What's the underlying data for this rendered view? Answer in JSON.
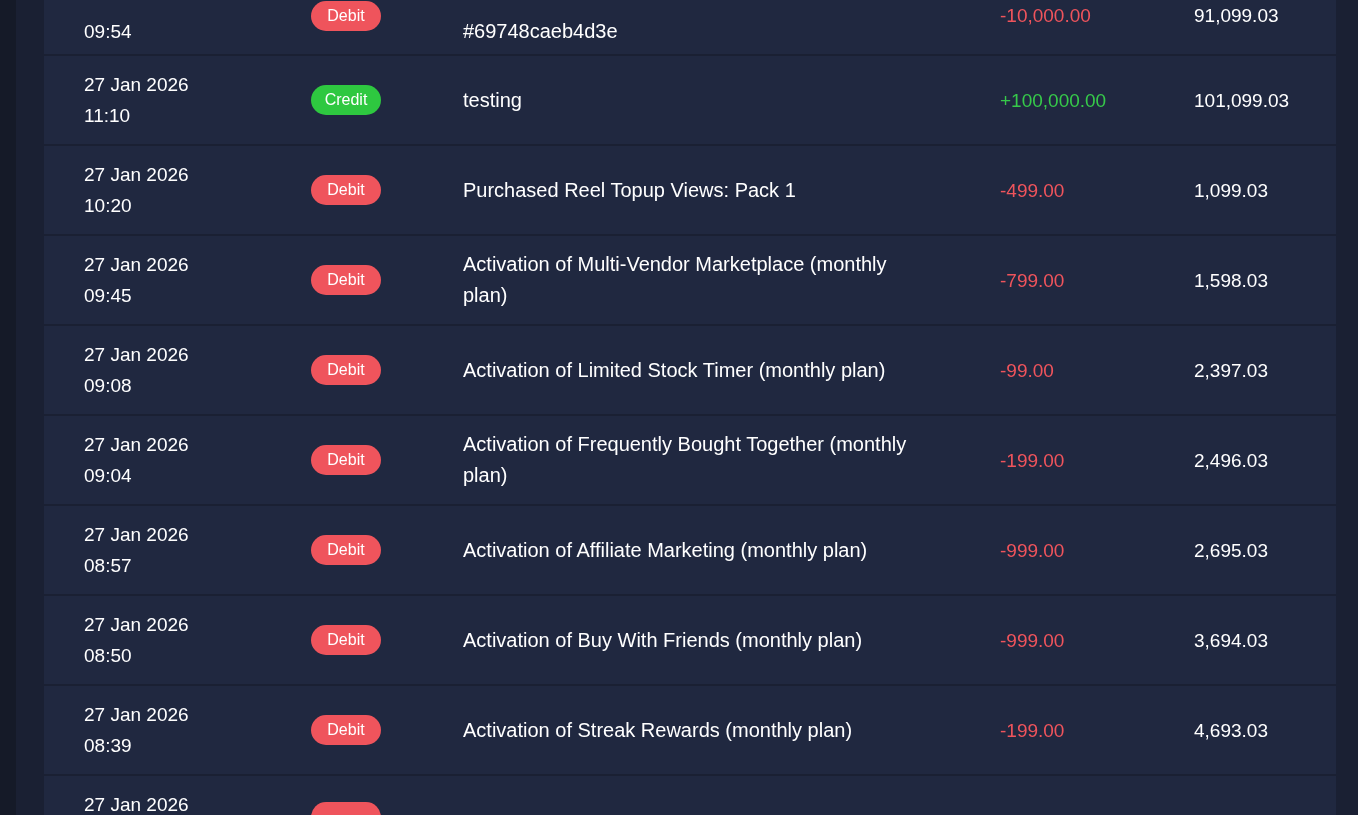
{
  "transactions": [
    {
      "kind": "cut_top",
      "time": "09:54",
      "credit": false,
      "type_label": "Debit",
      "description": "#69748caeb4d3e",
      "amount": "-10,000.00",
      "balance": "91,099.03"
    },
    {
      "kind": "full",
      "date": "27 Jan 2026",
      "time": "11:10",
      "credit": true,
      "type_label": "Credit",
      "description": "testing",
      "amount": "+100,000.00",
      "balance": "101,099.03"
    },
    {
      "kind": "full",
      "date": "27 Jan 2026",
      "time": "10:20",
      "credit": false,
      "type_label": "Debit",
      "description": "Purchased Reel Topup Views: Pack 1",
      "amount": "-499.00",
      "balance": "1,099.03"
    },
    {
      "kind": "full",
      "date": "27 Jan 2026",
      "time": "09:45",
      "credit": false,
      "type_label": "Debit",
      "description": "Activation of Multi-Vendor Marketplace (monthly plan)",
      "amount": "-799.00",
      "balance": "1,598.03"
    },
    {
      "kind": "full",
      "date": "27 Jan 2026",
      "time": "09:08",
      "credit": false,
      "type_label": "Debit",
      "description": "Activation of Limited Stock Timer (monthly plan)",
      "amount": "-99.00",
      "balance": "2,397.03"
    },
    {
      "kind": "full",
      "date": "27 Jan 2026",
      "time": "09:04",
      "credit": false,
      "type_label": "Debit",
      "description": "Activation of Frequently Bought Together (monthly plan)",
      "amount": "-199.00",
      "balance": "2,496.03"
    },
    {
      "kind": "full",
      "date": "27 Jan 2026",
      "time": "08:57",
      "credit": false,
      "type_label": "Debit",
      "description": "Activation of Affiliate Marketing (monthly plan)",
      "amount": "-999.00",
      "balance": "2,695.03"
    },
    {
      "kind": "full",
      "date": "27 Jan 2026",
      "time": "08:50",
      "credit": false,
      "type_label": "Debit",
      "description": "Activation of Buy With Friends (monthly plan)",
      "amount": "-999.00",
      "balance": "3,694.03"
    },
    {
      "kind": "full",
      "date": "27 Jan 2026",
      "time": "08:39",
      "credit": false,
      "type_label": "Debit",
      "description": "Activation of Streak Rewards (monthly plan)",
      "amount": "-199.00",
      "balance": "4,693.03"
    },
    {
      "kind": "cut_bottom",
      "date": "27 Jan 2026",
      "credit": false
    }
  ]
}
